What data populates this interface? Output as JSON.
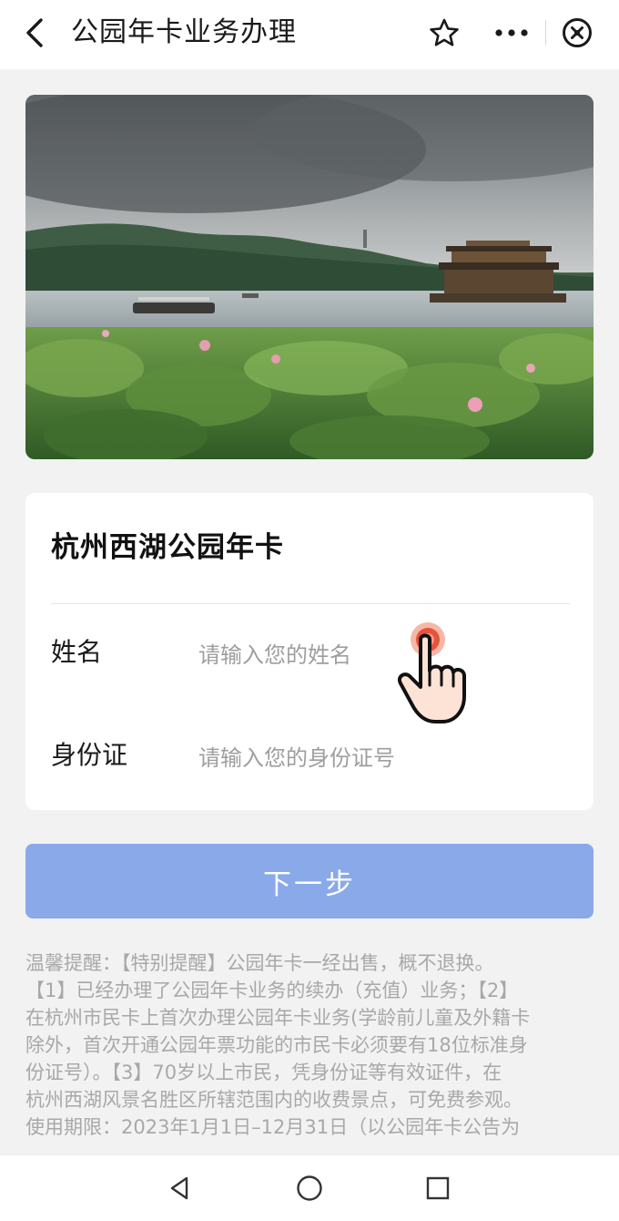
{
  "header": {
    "title": "公园年卡业务办理",
    "back_icon": "chevron-left-icon",
    "star_icon": "star-icon",
    "more_icon": "more-dots-icon",
    "close_icon": "close-circle-icon"
  },
  "hero": {
    "image_subject": "west-lake-lotus-pavilion-photo"
  },
  "card": {
    "title": "杭州西湖公园年卡",
    "fields": [
      {
        "label": "姓名",
        "placeholder": "请输入您的姓名",
        "value": ""
      },
      {
        "label": "身份证",
        "placeholder": "请输入您的身份证号",
        "value": ""
      }
    ]
  },
  "pointer": {
    "icon": "hand-pointer-icon"
  },
  "actions": {
    "next_label": "下一步",
    "next_color": "#8aa9e9"
  },
  "notice": {
    "lines": [
      "温馨提醒：【特别提醒】公园年卡一经出售，概不退换。",
      "【1】已经办理了公园年卡业务的续办（充值）业务；【2】",
      "在杭州市民卡上首次办理公园年卡业务(学龄前儿童及外籍卡",
      "除外，首次开通公园年票功能的市民卡必须要有18位标准身",
      "份证号）。【3】70岁以上市民，凭身份证等有效证件，在",
      "杭州西湖风景名胜区所辖范围内的收费景点，可免费参观。",
      "使用期限：2023年1月1日–12月31日（以公园年卡公告为"
    ]
  },
  "system_nav": {
    "back_icon": "triangle-back-icon",
    "home_icon": "circle-home-icon",
    "recent_icon": "square-recent-icon"
  }
}
